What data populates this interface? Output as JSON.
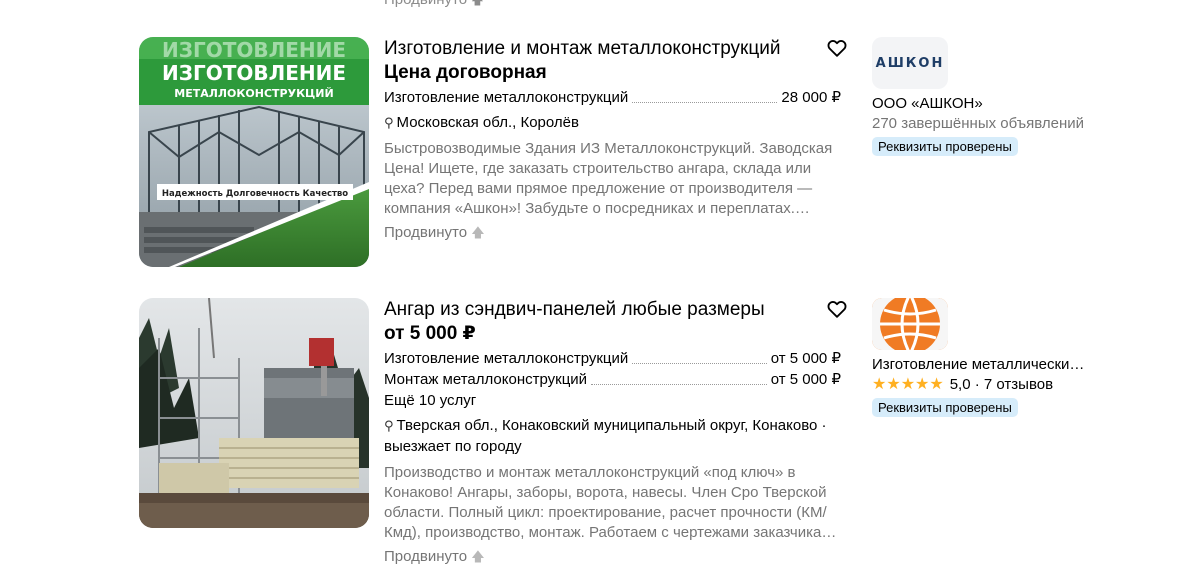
{
  "top_fragment": {
    "promo_label": "Продвинуто"
  },
  "listings": [
    {
      "title": "Изготовление и монтаж металлоконструкций",
      "price": "Цена договорная",
      "image_banner": {
        "line1": "ИЗГОТОВЛЕНИЕ",
        "line2": "МЕТАЛЛОКОНСТРУКЦИЙ",
        "tagline": "Надежность  Долговечность  Качество"
      },
      "services": [
        {
          "name": "Изготовление металлоконструкций",
          "price": "28 000 ₽"
        }
      ],
      "location": "Московская обл., Королёв",
      "description": "Быстровозводимые Здания ИЗ Металлоконструкций. Заводская Цена! Ищете, где заказать строительство ангара, склада или цеха? Перед вами прямое предложение от производителя — компания «Ашкон»! Забудьте о посредниках и переплатах.…",
      "promo_label": "Продвинуто",
      "seller": {
        "logo_text": "АШКОН",
        "name": "ООО «АШКОН»",
        "sub": "270 завершённых объявлений",
        "badge": "Реквизиты проверены"
      }
    },
    {
      "title": "Ангар из сэндвич-панелей любые размеры",
      "price": "от 5 000 ₽",
      "services": [
        {
          "name": "Изготовление металлоконструкций",
          "price": "от 5 000 ₽"
        },
        {
          "name": "Монтаж металлоконструкций",
          "price": "от 5 000 ₽"
        }
      ],
      "more_services": "Ещё 10 услуг",
      "location": "Тверская обл., Конаковский муниципальный округ, Конаково · выезжает по городу",
      "description": "Производство и монтаж металлоконструкций «под ключ» в Конаково! Ангары, заборы, ворота, навесы. Член Сро Тверской области. Полный цикл: проектирование, расчет прочности (КМ/Кмд), производство, монтаж. Работаем с чертежами заказчика…",
      "promo_label": "Продвинуто",
      "seller": {
        "name": "Изготовление металлически…",
        "rating": "5,0",
        "reviews": "· 7 отзывов",
        "rating_value": 5,
        "badge": "Реквизиты проверены"
      }
    }
  ],
  "colors": {
    "accent_badge": "#d6ecfa",
    "star": "#ffb021",
    "muted_text": "#757575"
  }
}
